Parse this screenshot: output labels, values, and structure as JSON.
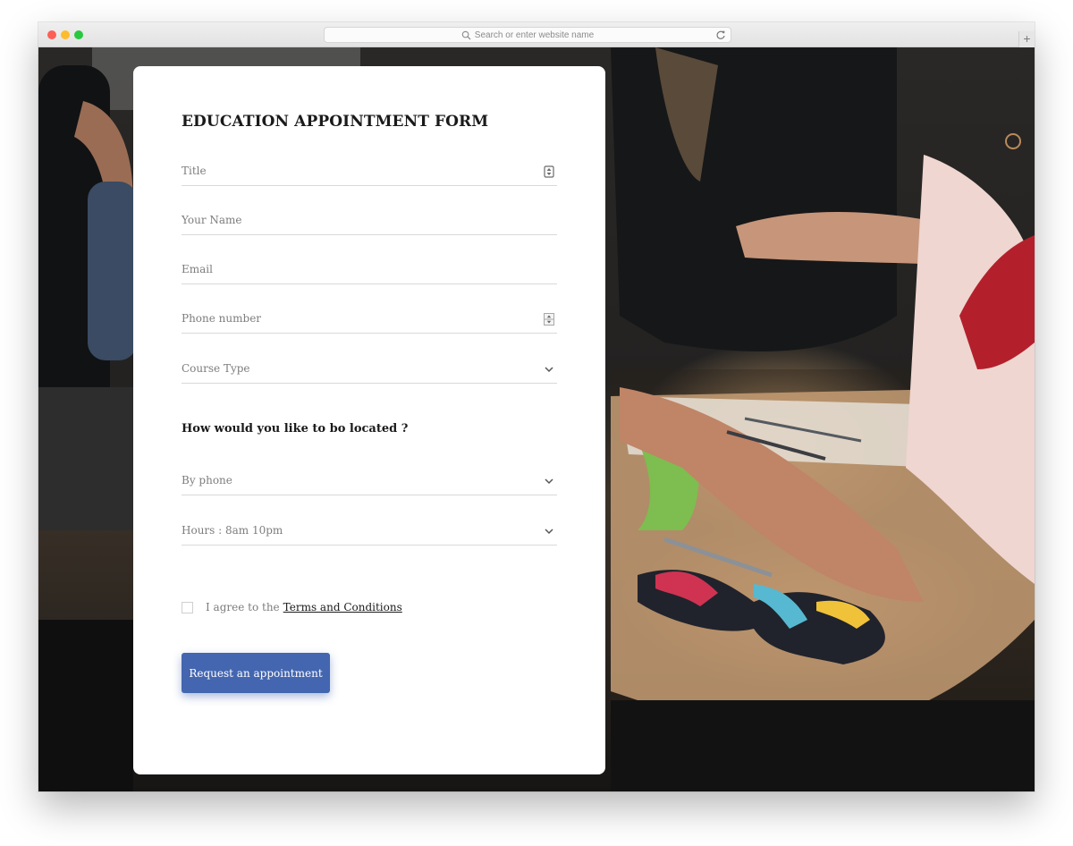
{
  "browser": {
    "url_placeholder": "Search or enter website name",
    "new_tab_label": "+"
  },
  "form": {
    "title": "EDUCATION APPOINTMENT FORM",
    "fields": {
      "title": {
        "placeholder": "Title"
      },
      "name": {
        "placeholder": "Your Name"
      },
      "email": {
        "placeholder": "Email"
      },
      "phone": {
        "placeholder": "Phone number"
      },
      "course_type": {
        "value": "Course Type"
      }
    },
    "location_question": "How would you like to bo located ?",
    "location": {
      "method": {
        "value": "By phone"
      },
      "hours": {
        "value": "Hours : 8am 10pm"
      }
    },
    "agree_text": "I agree to the",
    "terms_link": "Terms and Conditions",
    "submit_label": "Request an appointment"
  },
  "colors": {
    "accent": "#4466b0",
    "page_background": "#ffffff",
    "card_background": "#ffffff",
    "placeholder_text": "#7d7d7d",
    "divider": "#d9d9d9"
  },
  "icons": {
    "title_field": "sort-arrows-icon",
    "phone_field": "number-spinner-icon",
    "dropdowns": "chevron-down-icon",
    "search": "search-icon",
    "reload": "reload-icon"
  }
}
